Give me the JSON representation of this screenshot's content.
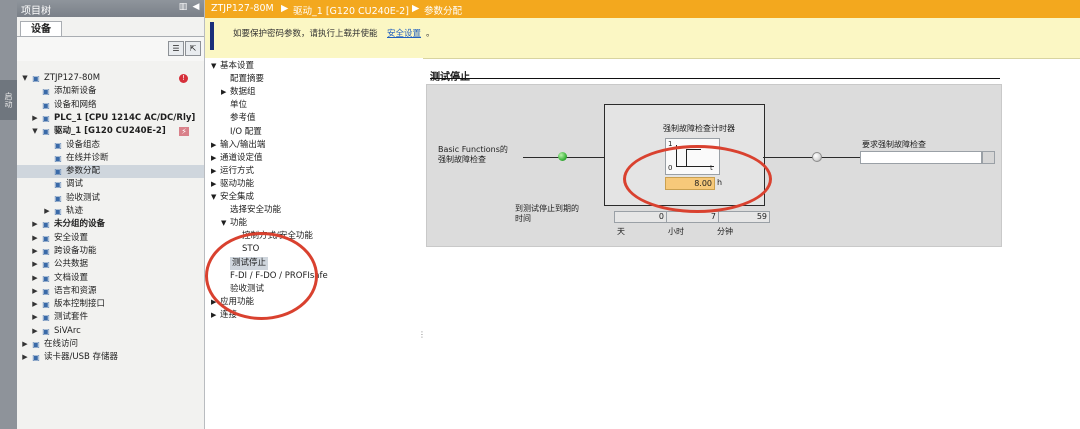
{
  "left_strip": {
    "label": "启动"
  },
  "tree": {
    "title": "项目树",
    "tab": "设备",
    "items": [
      {
        "label": "ZTJP127-80M",
        "level": 0,
        "toggle": "▼",
        "icon": "project-icon",
        "badge": "error"
      },
      {
        "label": "添加新设备",
        "level": 1,
        "toggle": "",
        "icon": "add-device-icon"
      },
      {
        "label": "设备和网络",
        "level": 1,
        "toggle": "",
        "icon": "network-icon"
      },
      {
        "label": "PLC_1 [CPU 1214C AC/DC/Rly]",
        "level": 1,
        "toggle": "▶",
        "icon": "plc-icon",
        "bold": true
      },
      {
        "label": "驱动_1 [G120 CU240E-2]",
        "level": 1,
        "toggle": "▼",
        "icon": "drive-icon",
        "bold": true,
        "badge": "drive"
      },
      {
        "label": "设备组态",
        "level": 2,
        "toggle": "",
        "icon": "device-config-icon"
      },
      {
        "label": "在线并诊断",
        "level": 2,
        "toggle": "",
        "icon": "online-diag-icon"
      },
      {
        "label": "参数分配",
        "level": 2,
        "toggle": "",
        "icon": "parameter-icon",
        "selected": true
      },
      {
        "label": "调试",
        "level": 2,
        "toggle": "",
        "icon": "commissioning-icon"
      },
      {
        "label": "验收测试",
        "level": 2,
        "toggle": "",
        "icon": "acceptance-test-icon"
      },
      {
        "label": "轨迹",
        "level": 2,
        "toggle": "▶",
        "icon": "trace-icon"
      },
      {
        "label": "未分组的设备",
        "level": 1,
        "toggle": "▶",
        "icon": "ungrouped-icon",
        "bold": true
      },
      {
        "label": "安全设置",
        "level": 1,
        "toggle": "▶",
        "icon": "security-icon"
      },
      {
        "label": "跨设备功能",
        "level": 1,
        "toggle": "▶",
        "icon": "cross-device-icon"
      },
      {
        "label": "公共数据",
        "level": 1,
        "toggle": "▶",
        "icon": "common-data-icon"
      },
      {
        "label": "文档设置",
        "level": 1,
        "toggle": "▶",
        "icon": "doc-settings-icon"
      },
      {
        "label": "语言和资源",
        "level": 1,
        "toggle": "▶",
        "icon": "language-icon"
      },
      {
        "label": "版本控制接口",
        "level": 1,
        "toggle": "▶",
        "icon": "version-control-icon"
      },
      {
        "label": "测试套件",
        "level": 1,
        "toggle": "▶",
        "icon": "test-suite-icon"
      },
      {
        "label": "SiVArc",
        "level": 1,
        "toggle": "▶",
        "icon": "sivarc-icon"
      },
      {
        "label": "在线访问",
        "level": 0,
        "toggle": "▶",
        "icon": "online-access-icon"
      },
      {
        "label": "读卡器/USB 存储器",
        "level": 0,
        "toggle": "▶",
        "icon": "card-reader-icon"
      }
    ]
  },
  "breadcrumb": {
    "items": [
      "ZTJP127-80M",
      "驱动_1 [G120 CU240E-2]",
      "参数分配"
    ],
    "separator": "▶"
  },
  "info_bar": {
    "text": "如要保护密码参数，请执行上载并使能",
    "link": "安全设置",
    "end": "。"
  },
  "nav": {
    "items": [
      {
        "label": "基本设置",
        "level": 0,
        "toggle": "▼"
      },
      {
        "label": "配置摘要",
        "level": 1,
        "toggle": ""
      },
      {
        "label": "数据组",
        "level": 1,
        "toggle": "▶"
      },
      {
        "label": "单位",
        "level": 1,
        "toggle": ""
      },
      {
        "label": "参考值",
        "level": 1,
        "toggle": ""
      },
      {
        "label": "I/O 配置",
        "level": 1,
        "toggle": ""
      },
      {
        "label": "输入/输出端",
        "level": 0,
        "toggle": "▶"
      },
      {
        "label": "通道设定值",
        "level": 0,
        "toggle": "▶"
      },
      {
        "label": "运行方式",
        "level": 0,
        "toggle": "▶"
      },
      {
        "label": "驱动功能",
        "level": 0,
        "toggle": "▶"
      },
      {
        "label": "安全集成",
        "level": 0,
        "toggle": "▼"
      },
      {
        "label": "选择安全功能",
        "level": 1,
        "toggle": ""
      },
      {
        "label": "功能",
        "level": 1,
        "toggle": "▼"
      },
      {
        "label": "控制方式/安全功能",
        "level": 2,
        "toggle": ""
      },
      {
        "label": "STO",
        "level": 2,
        "toggle": ""
      },
      {
        "label": "测试停止",
        "level": 1,
        "toggle": "",
        "selected": true
      },
      {
        "label": "F-DI / F-DO / PROFIsafe",
        "level": 1,
        "toggle": ""
      },
      {
        "label": "验收测试",
        "level": 1,
        "toggle": ""
      },
      {
        "label": "应用功能",
        "level": 0,
        "toggle": "▶"
      },
      {
        "label": "连接",
        "level": 0,
        "toggle": "▶"
      }
    ]
  },
  "content": {
    "title": "测试停止",
    "input_label_line1": "Basic Functions的",
    "input_label_line2": "强制故障检查",
    "timer_title": "强制故障检查计时器",
    "timer_top": "1",
    "timer_zero": "0",
    "timer_t": "t",
    "timer_value": "8.00",
    "timer_unit": "h",
    "output_label": "要求强制故障检查",
    "output_value": "",
    "remaining_label_line1": "到测试停止到期的",
    "remaining_label_line2": "时间",
    "remaining": {
      "days": "0",
      "hours": "7",
      "minutes": "59"
    },
    "units": {
      "days": "天",
      "hours": "小时",
      "minutes": "分钟"
    }
  },
  "colors": {
    "breadcrumb_bg": "#f3a81e",
    "info_bg": "#fbf7c4",
    "led_green": "#3cb43c",
    "highlight_field": "#f7c97a",
    "annotation_red": "#d9412f"
  }
}
